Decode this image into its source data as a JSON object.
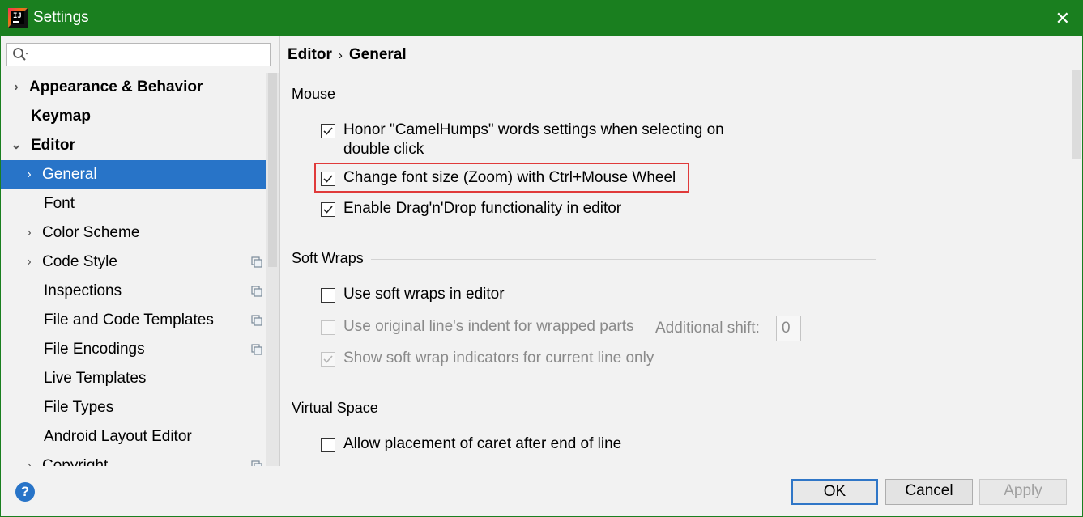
{
  "window": {
    "title": "Settings",
    "close_icon": "close-icon",
    "app_icon": "intellij-idea-icon"
  },
  "colors": {
    "titlebar": "#1a7f1f",
    "selection": "#2874c8",
    "highlight_border": "#e03a3a"
  },
  "search": {
    "placeholder": "",
    "value": "",
    "icon": "search-icon"
  },
  "sidebar": {
    "items": [
      {
        "label": "Appearance & Behavior",
        "expanded": false
      },
      {
        "label": "Keymap"
      },
      {
        "label": "Editor",
        "expanded": true
      },
      {
        "label": "General",
        "selected": true,
        "expanded": false
      },
      {
        "label": "Font"
      },
      {
        "label": "Color Scheme",
        "expanded": false
      },
      {
        "label": "Code Style",
        "expanded": false,
        "icon": "copy-icon"
      },
      {
        "label": "Inspections",
        "icon": "copy-icon"
      },
      {
        "label": "File and Code Templates",
        "icon": "copy-icon"
      },
      {
        "label": "File Encodings",
        "icon": "copy-icon"
      },
      {
        "label": "Live Templates"
      },
      {
        "label": "File Types"
      },
      {
        "label": "Android Layout Editor"
      },
      {
        "label": "Copyright",
        "expanded": false,
        "icon": "copy-icon"
      }
    ]
  },
  "breadcrumb": {
    "parent": "Editor",
    "separator": "›",
    "current": "General"
  },
  "sections": {
    "mouse": {
      "title": "Mouse",
      "options": [
        {
          "line1": "Honor \"CamelHumps\" words settings when selecting on",
          "line2": "double click",
          "checked": true
        },
        {
          "label": "Change font size (Zoom) with Ctrl+Mouse Wheel",
          "checked": true,
          "highlighted": true
        },
        {
          "label": "Enable Drag'n'Drop functionality in editor",
          "checked": true
        }
      ]
    },
    "soft_wraps": {
      "title": "Soft Wraps",
      "options": [
        {
          "label": "Use soft wraps in editor",
          "checked": false
        },
        {
          "label": "Use original line's indent for wrapped parts",
          "checked": false,
          "disabled": true
        },
        {
          "label": "Show soft wrap indicators for current line only",
          "checked": true,
          "disabled": true
        }
      ],
      "additional_shift": {
        "label": "Additional shift:",
        "value": "0"
      }
    },
    "virtual_space": {
      "title": "Virtual Space",
      "options": [
        {
          "label": "Allow placement of caret after end of line",
          "checked": false
        }
      ]
    }
  },
  "footer": {
    "help": "?",
    "ok": "OK",
    "cancel": "Cancel",
    "apply": "Apply"
  }
}
